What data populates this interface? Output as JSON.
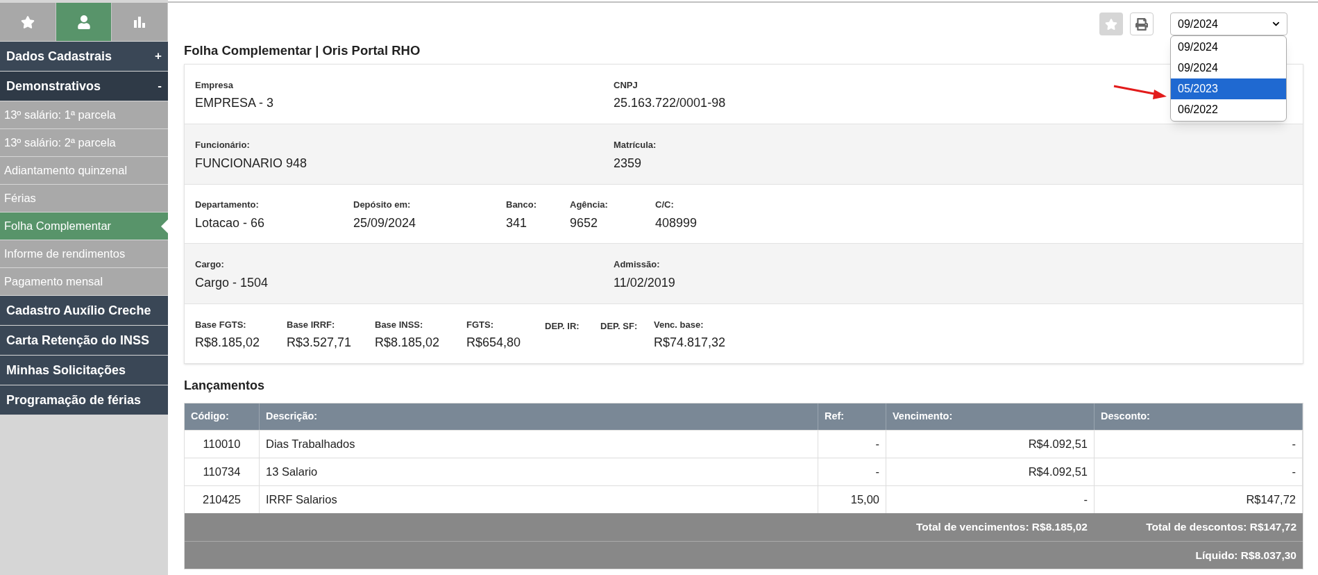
{
  "sidebar": {
    "tabs": [
      {
        "kind": "star",
        "selected": false
      },
      {
        "kind": "user",
        "selected": true
      },
      {
        "kind": "chart",
        "selected": false
      }
    ],
    "sections": [
      {
        "label": "Dados Cadastrais",
        "toggle": "+",
        "expanded": false
      },
      {
        "label": "Demonstrativos",
        "toggle": "-",
        "expanded": true,
        "children": [
          {
            "label": "13º salário: 1ª parcela",
            "selected": false
          },
          {
            "label": "13º salário: 2ª parcela",
            "selected": false
          },
          {
            "label": "Adiantamento quinzenal",
            "selected": false
          },
          {
            "label": "Férias",
            "selected": false
          },
          {
            "label": "Folha Complementar",
            "selected": true
          },
          {
            "label": "Informe de rendimentos",
            "selected": false
          },
          {
            "label": "Pagamento mensal",
            "selected": false
          }
        ]
      },
      {
        "label": "Cadastro Auxílio Creche",
        "expanded": false
      },
      {
        "label": "Carta Retenção do INSS",
        "expanded": false
      },
      {
        "label": "Minhas Solicitações",
        "expanded": false
      },
      {
        "label": "Programação de férias",
        "expanded": false
      }
    ]
  },
  "toolbar": {
    "favorite_disabled": true,
    "period_select": {
      "value": "09/2024",
      "expanded": true,
      "options": [
        {
          "label": "09/2024",
          "highlighted": false
        },
        {
          "label": "09/2024",
          "highlighted": false
        },
        {
          "label": "05/2023",
          "highlighted": true
        },
        {
          "label": "06/2022",
          "highlighted": false
        }
      ]
    }
  },
  "title": "Folha Complementar | Oris Portal RHO",
  "details": [
    [
      {
        "label": "Empresa",
        "value": "EMPRESA - 3"
      },
      {
        "label": "CNPJ",
        "value": "25.163.722/0001-98"
      }
    ],
    [
      {
        "label": "Funcionário:",
        "value": "FUNCIONARIO 948"
      },
      {
        "label": "Matrícula:",
        "value": "2359"
      }
    ],
    [
      {
        "label": "Departamento:",
        "value": "Lotacao - 66"
      },
      {
        "label": "Depósito em:",
        "value": "25/09/2024"
      },
      {
        "label": "Banco:",
        "value": "341"
      },
      {
        "label": "Agência:",
        "value": "9652"
      },
      {
        "label": "C/C:",
        "value": "408999"
      }
    ],
    [
      {
        "label": "Cargo:",
        "value": "Cargo - 1504"
      },
      {
        "label": "Admissão:",
        "value": "11/02/2019"
      }
    ],
    [
      {
        "label": "Base FGTS:",
        "value": "R$8.185,02"
      },
      {
        "label": "Base IRRF:",
        "value": "R$3.527,71"
      },
      {
        "label": "Base INSS:",
        "value": "R$8.185,02"
      },
      {
        "label": "FGTS:",
        "value": "R$654,80"
      },
      {
        "label": "DEP. IR:"
      },
      {
        "label": "DEP. SF:"
      },
      {
        "label": "Venc. base:",
        "value": "R$74.817,32"
      }
    ]
  ],
  "entries": {
    "heading": "Lançamentos",
    "columns": [
      "Código:",
      "Descrição:",
      "Ref:",
      "Vencimento:",
      "Desconto:"
    ],
    "rows": [
      [
        "110010",
        "Dias Trabalhados",
        "-",
        "R$4.092,51",
        "-"
      ],
      [
        "110734",
        "13 Salario",
        "-",
        "R$4.092,51",
        "-"
      ],
      [
        "210425",
        "IRRF Salarios",
        "15,00",
        "-",
        "R$147,72"
      ]
    ],
    "total_earnings": "Total de vencimentos: R$8.185,02",
    "total_deductions": "Total de descontos: R$147,72",
    "net": "Líquido: R$8.037,30"
  }
}
